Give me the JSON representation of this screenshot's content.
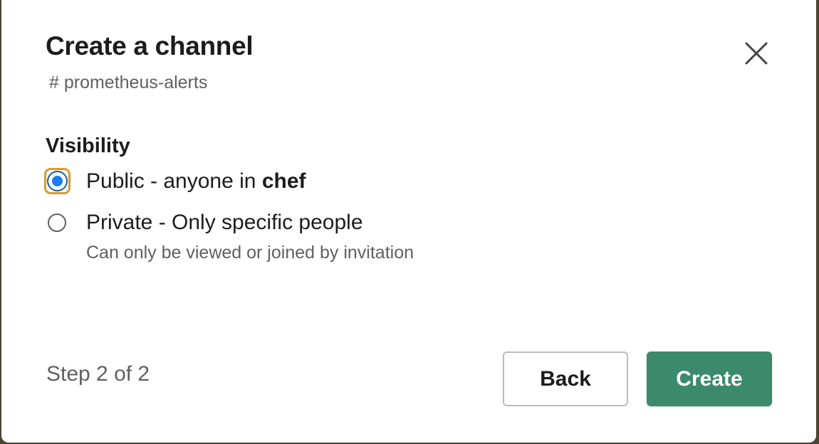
{
  "dialog": {
    "title": "Create a channel",
    "channel_name": "# prometheus-alerts",
    "close_icon": "close-icon"
  },
  "visibility": {
    "label": "Visibility",
    "options": [
      {
        "id": "public",
        "label_prefix": "Public - anyone in ",
        "label_bold": "chef",
        "selected": true
      },
      {
        "id": "private",
        "label": "Private - Only specific people",
        "hint": "Can only be viewed or joined by invitation",
        "selected": false
      }
    ]
  },
  "footer": {
    "step": "Step 2 of 2",
    "back_label": "Back",
    "create_label": "Create"
  },
  "colors": {
    "primary_button": "#3c8a6b",
    "radio_selected": "#1d7cf2",
    "focus_ring": "#d99a2e"
  }
}
